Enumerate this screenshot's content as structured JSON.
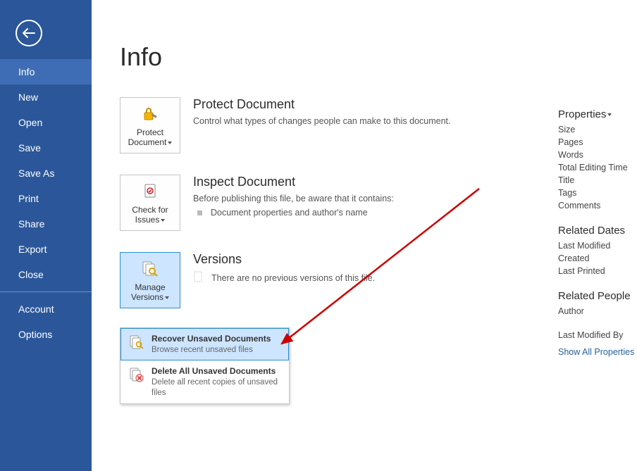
{
  "sidebar": {
    "items": [
      {
        "label": "Info"
      },
      {
        "label": "New"
      },
      {
        "label": "Open"
      },
      {
        "label": "Save"
      },
      {
        "label": "Save As"
      },
      {
        "label": "Print"
      },
      {
        "label": "Share"
      },
      {
        "label": "Export"
      },
      {
        "label": "Close"
      }
    ],
    "bottom": [
      {
        "label": "Account"
      },
      {
        "label": "Options"
      }
    ]
  },
  "page": {
    "title": "Info"
  },
  "protect": {
    "button": "Protect Document",
    "heading": "Protect Document",
    "body": "Control what types of changes people can make to this document."
  },
  "inspect": {
    "button": "Check for Issues",
    "heading": "Inspect Document",
    "lead": "Before publishing this file, be aware that it contains:",
    "bullet": "Document properties and author's name"
  },
  "versions": {
    "button": "Manage Versions",
    "heading": "Versions",
    "empty": "There are no previous versions of this file."
  },
  "dropdown": {
    "recover": {
      "title": "Recover Unsaved Documents",
      "sub": "Browse recent unsaved files"
    },
    "delete": {
      "title": "Delete All Unsaved Documents",
      "sub": "Delete all recent copies of unsaved files"
    }
  },
  "right": {
    "properties_heading": "Properties",
    "props": [
      "Size",
      "Pages",
      "Words",
      "Total Editing Time",
      "Title",
      "Tags",
      "Comments"
    ],
    "dates_heading": "Related Dates",
    "dates": [
      "Last Modified",
      "Created",
      "Last Printed"
    ],
    "people_heading": "Related People",
    "people": [
      "Author"
    ],
    "last_mod_by": "Last Modified By",
    "show_all": "Show All Properties"
  }
}
